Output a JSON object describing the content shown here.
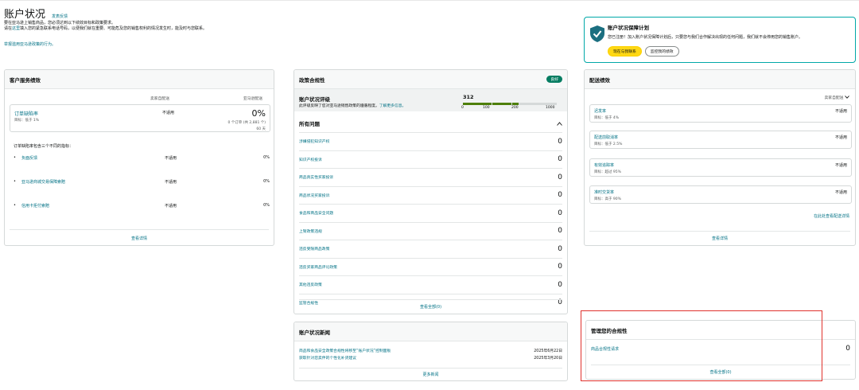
{
  "header": {
    "title": "账户状况",
    "feedback": "发表反馈",
    "desc1": "要在亚马逊上销售商品，您必须达到以下绩效目标和政策要求。",
    "desc2_pre": "请在",
    "desc2_link": "这里",
    "desc2_post": "填入您的紧急联系电话号码，以便我们就在重要、可能危及您的销售权利的情况发生时，能及时与您联系。",
    "report_link": "举报滥用亚马逊政策的行为。"
  },
  "guarantee": {
    "title": "账户状况保障计划",
    "desc": "您已注册！加入账户状况保障计划后，只要您与我们合作解决出现的任何问题，我们就不会停用您的销售账户。",
    "btn_contact": "现在与我联系",
    "btn_monitor": "监控我的绩效",
    "colors": {
      "border": "#00a8a8",
      "shield": "#1b6f80"
    }
  },
  "customer_service": {
    "title": "客户服务绩效",
    "col_seller": "卖家自配送",
    "col_fba": "亚马逊配送",
    "odr_label": "订单缺陷率",
    "odr_target": "目标：低于 1%",
    "odr_seller": "不适用",
    "odr_fba": "0%",
    "odr_orders": "0 个订单 (共 2,881 个)",
    "odr_days": "60 天",
    "note": "订单缺陷率包含三个不同的指标：",
    "metrics": [
      {
        "label": "负面反馈",
        "seller": "不适用",
        "fba": "0%"
      },
      {
        "label": "亚马逊商城交易保障索赔",
        "seller": "不适用",
        "fba": "0%"
      },
      {
        "label": "信用卡拒付索赔",
        "seller": "不适用",
        "fba": "0%"
      }
    ],
    "bullet": "•",
    "footer": "查看详情"
  },
  "policy": {
    "title": "政策合规性",
    "badge": "良好",
    "rating_title": "账户状况评级",
    "rating_desc": "此评级反映了您对亚马逊销售政策的遵循程度。",
    "learn_more": "了解更多信息。",
    "score": 312,
    "score_max": 1000,
    "ticks": [
      "0",
      "100",
      "200",
      "1000"
    ],
    "issues_title": "所有问题",
    "issues": [
      {
        "label": "涉嫌侵犯知识产权",
        "count": "0"
      },
      {
        "label": "知识产权投诉",
        "count": "0"
      },
      {
        "label": "商品真实性买家投诉",
        "count": "0"
      },
      {
        "label": "商品状况买家投诉",
        "count": "0"
      },
      {
        "label": "食品和商品安全问题",
        "count": "0"
      },
      {
        "label": "上架政策违规",
        "count": "0"
      },
      {
        "label": "违反受限商品政策",
        "count": "0"
      },
      {
        "label": "违反买家商品评论政策",
        "count": "0"
      },
      {
        "label": "其他违反政策",
        "count": "0"
      },
      {
        "label": "监管合规性",
        "count": "0"
      }
    ],
    "footer": "查看全部(0)",
    "colors": {
      "bar_fill": "#4e7f0a",
      "bar_track": "#d5d9d9",
      "badge": "#067d62"
    }
  },
  "shipping": {
    "title": "配送绩效",
    "scope": "卖家自配送",
    "metrics": [
      {
        "label": "迟发率",
        "target": "目标：低于 4%",
        "value": "不适用"
      },
      {
        "label": "配送前取消率",
        "target": "目标：低于 2.5%",
        "value": "不适用"
      },
      {
        "label": "有效追踪率",
        "target": "目标：超过 95%",
        "value": "不适用"
      },
      {
        "label": "准时交货率",
        "target": "目标：高于 90%",
        "value": "不适用"
      }
    ],
    "more_link": "在此处查看配送详情",
    "footer": "查看详情"
  },
  "news": {
    "title": "账户状况新闻",
    "items": [
      {
        "text": "简品和食品安全政策合规性将移至“账户状况”控制面板",
        "date": "2025年6月22日"
      },
      {
        "text": "获取针对您卖伴的个性化补货建议",
        "date": "2025年3月20日"
      }
    ],
    "footer": "更多新闻"
  },
  "manage": {
    "title": "管理您的合规性",
    "row_label": "商品合规性请求",
    "row_count": "0",
    "footer": "查看全部(0)"
  }
}
